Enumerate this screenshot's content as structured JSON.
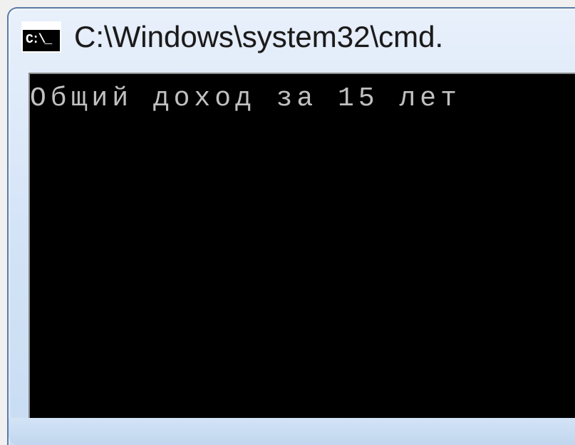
{
  "window": {
    "title": "C:\\Windows\\system32\\cmd."
  },
  "console": {
    "output_line_1": "Общий доход за 15 лет"
  }
}
